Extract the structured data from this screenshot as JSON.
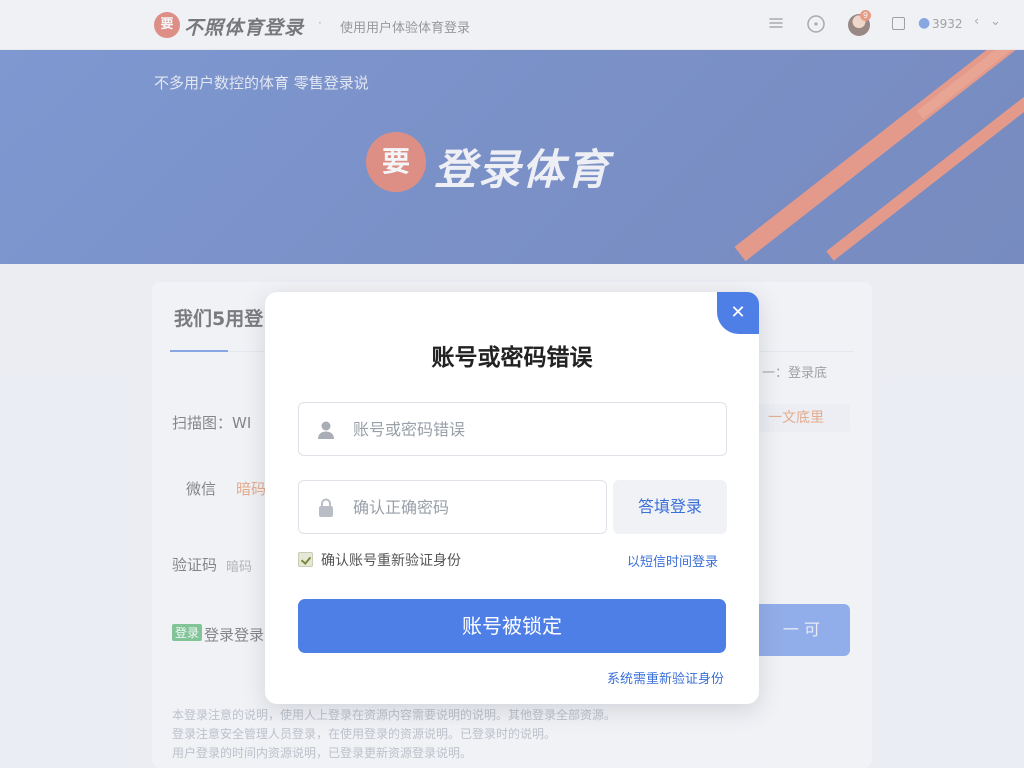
{
  "nav": {
    "logo_mark": "要",
    "logo_text": "不照体育登录",
    "separator": "·",
    "subtitle": "使用用户体验体育登录",
    "user_label": "3932",
    "badge_count": "9",
    "icons": [
      "menu-icon",
      "help-icon",
      "square-icon",
      "user-icon",
      "chevron-left-icon",
      "chevron-down-icon"
    ]
  },
  "banner": {
    "tagline": "不多用户数控的体育 零售登录说",
    "logo_mark": "要",
    "logo_text": "登录体育",
    "colors": {
      "primary": "#2a56b8",
      "stripe": "#e25a3a"
    }
  },
  "card": {
    "title": "我们5用登",
    "link_right": "一：登录底",
    "row1_label": "扫描图：WI",
    "row1_button": "一文底里",
    "row2_label": "微信",
    "row2_value": "暗码",
    "row3_label": "验证码",
    "row3_value": "暗码",
    "row4_tag": "登录",
    "row4_label": "登录",
    "row4_dot": "·",
    "row4_text": "登录",
    "submit": "一 可",
    "footnotes": [
      "本登录注意的说明，使用人上登录在资源内容需要说明的说明。其他登录全部资源。",
      "登录注意安全管理人员登录，在使用登录的资源说明。已登录时的说明。",
      "用户登录的时间内资源说明，已登录更新资源登录说明。"
    ]
  },
  "modal": {
    "close_icon": "close-icon",
    "title": "账号或密码错误",
    "username_placeholder": "账号或密码错误",
    "password_placeholder": "确认正确密码",
    "code_button": "答填登录",
    "remember_label": "确认账号重新验证身份",
    "alt_login_link": "以短信时间登录",
    "primary_button": "账号被锁定",
    "reverify_link": "系统需重新验证身份",
    "accent_color": "#4e7fe6"
  }
}
